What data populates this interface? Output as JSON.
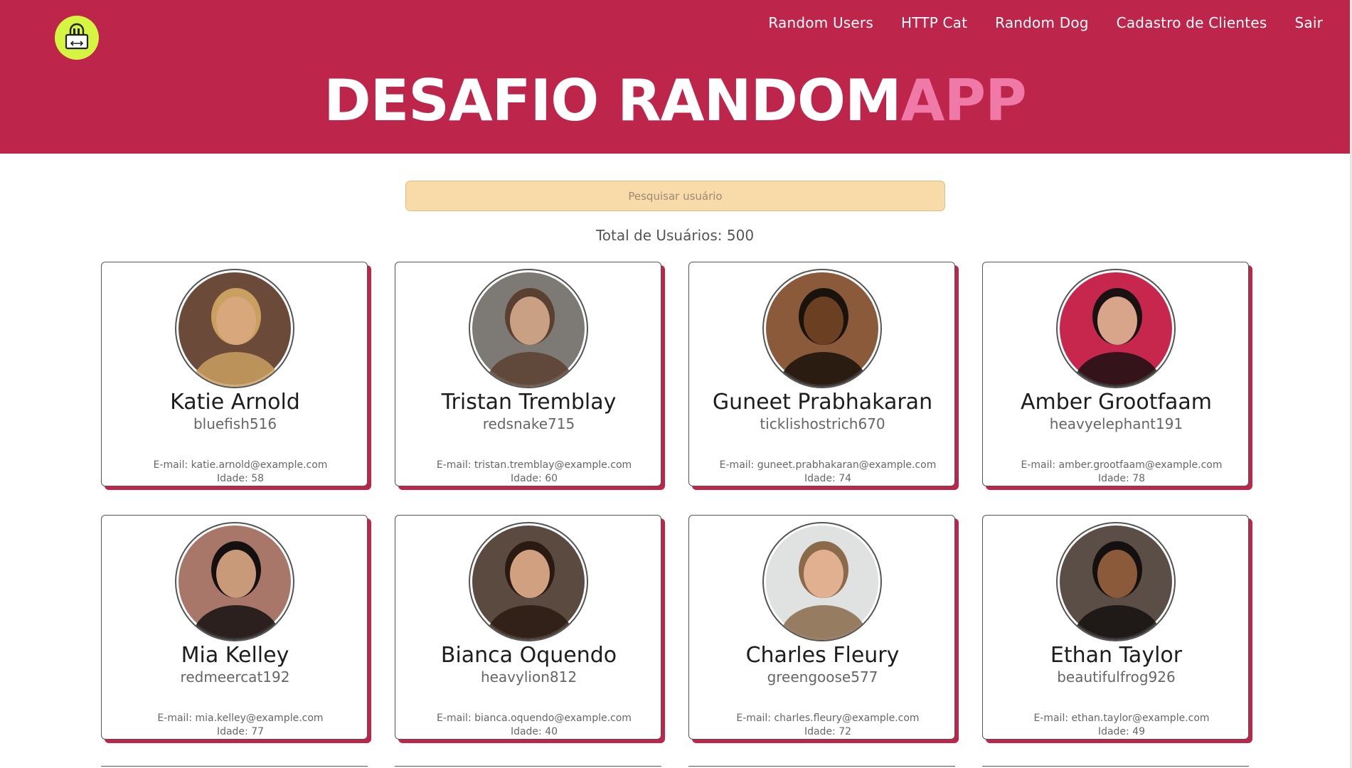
{
  "app": {
    "title_main": "DESAFIO RANDOM",
    "title_accent": "APP",
    "accent_color": "#be254b",
    "accent_pink": "#f07aa7"
  },
  "nav": {
    "items": [
      {
        "label": "Random Users"
      },
      {
        "label": "HTTP Cat"
      },
      {
        "label": "Random Dog"
      },
      {
        "label": "Cadastro de Clientes"
      },
      {
        "label": "Sair"
      }
    ]
  },
  "search": {
    "placeholder": "Pesquisar usuário",
    "value": ""
  },
  "summary": {
    "total_label": "Total de Usuários: 500"
  },
  "users": [
    {
      "name": "Katie Arnold",
      "username": "bluefish516",
      "email": "E-mail: katie.arnold@example.com",
      "age": "Idade: 58",
      "avatar_bg": "#6b4a3a",
      "skin": "#d9a77c",
      "hair": "#c9a060"
    },
    {
      "name": "Tristan Tremblay",
      "username": "redsnake715",
      "email": "E-mail: tristan.tremblay@example.com",
      "age": "Idade: 60",
      "avatar_bg": "#7d7a75",
      "skin": "#caa085",
      "hair": "#5a4030"
    },
    {
      "name": "Guneet Prabhakaran",
      "username": "ticklishostrich670",
      "email": "E-mail: guneet.prabhakaran@example.com",
      "age": "Idade: 74",
      "avatar_bg": "#8a5a3a",
      "skin": "#6a3f22",
      "hair": "#1a120c"
    },
    {
      "name": "Amber Grootfaam",
      "username": "heavyelephant191",
      "email": "E-mail: amber.grootfaam@example.com",
      "age": "Idade: 78",
      "avatar_bg": "#c8274d",
      "skin": "#d8a48a",
      "hair": "#1a1212"
    },
    {
      "name": "Mia Kelley",
      "username": "redmeercat192",
      "email": "E-mail: mia.kelley@example.com",
      "age": "Idade: 77",
      "avatar_bg": "#a8776a",
      "skin": "#c89a7a",
      "hair": "#151010"
    },
    {
      "name": "Bianca Oquendo",
      "username": "heavylion812",
      "email": "E-mail: bianca.oquendo@example.com",
      "age": "Idade: 40",
      "avatar_bg": "#5b4a40",
      "skin": "#d0a080",
      "hair": "#2a1a12"
    },
    {
      "name": "Charles Fleury",
      "username": "greengoose577",
      "email": "E-mail: charles.fleury@example.com",
      "age": "Idade: 72",
      "avatar_bg": "#dfe2e0",
      "skin": "#e0b090",
      "hair": "#8a6a4a"
    },
    {
      "name": "Ethan Taylor",
      "username": "beautifulfrog926",
      "email": "E-mail: ethan.taylor@example.com",
      "age": "Idade: 49",
      "avatar_bg": "#5a4e46",
      "skin": "#8a5a3a",
      "hair": "#151010"
    }
  ]
}
